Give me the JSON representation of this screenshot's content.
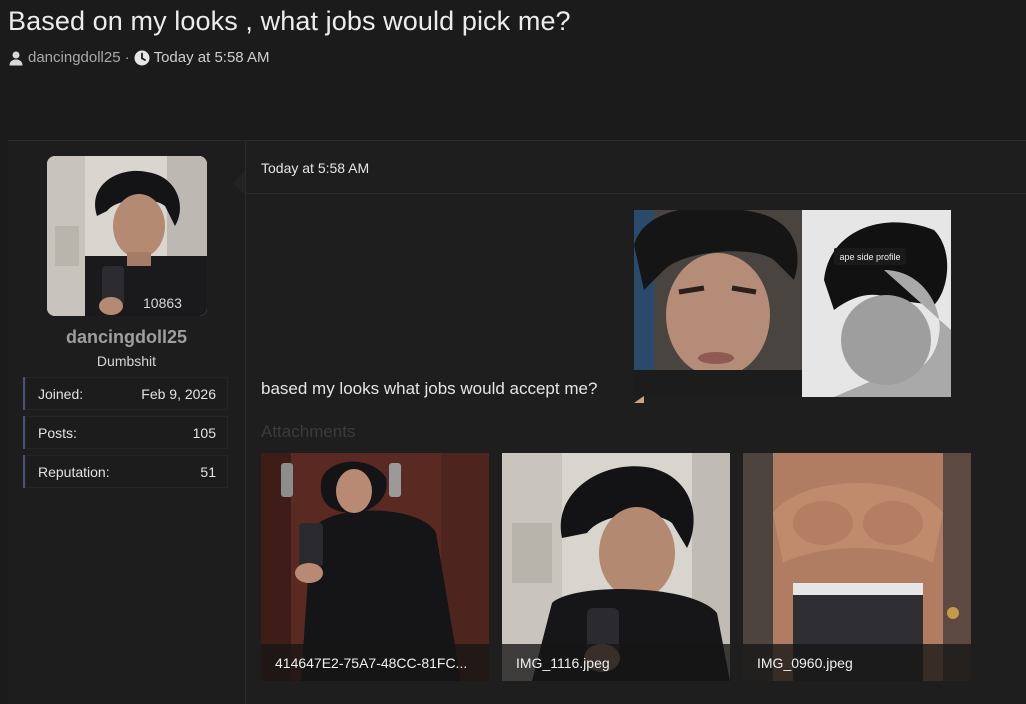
{
  "thread": {
    "title": "Based on my looks , what jobs would pick me?",
    "author": "dancingdoll25",
    "separator": "·",
    "timestamp": "Today at 5:58 AM"
  },
  "user": {
    "name": "dancingdoll25",
    "title": "Dumbshit",
    "stats": [
      {
        "label": "Joined:",
        "value": "Feb 9, 2026"
      },
      {
        "label": "Posts:",
        "value": "105"
      },
      {
        "label": "Reputation:",
        "value": "51"
      }
    ]
  },
  "post": {
    "date": "Today at 5:58 AM",
    "body": "based my looks what jobs would accept me?",
    "image_caption": "ape side profile",
    "attachments_label": "Attachments",
    "attachments": [
      {
        "filename": "414647E2-75A7-48CC-81FC..."
      },
      {
        "filename": "IMG_1116.jpeg"
      },
      {
        "filename": "IMG_0960.jpeg"
      }
    ]
  },
  "colors": {
    "accent": "#4a4f7c",
    "background": "#1b1b1b"
  },
  "icons": {
    "author": "user-icon",
    "time": "clock-icon"
  }
}
